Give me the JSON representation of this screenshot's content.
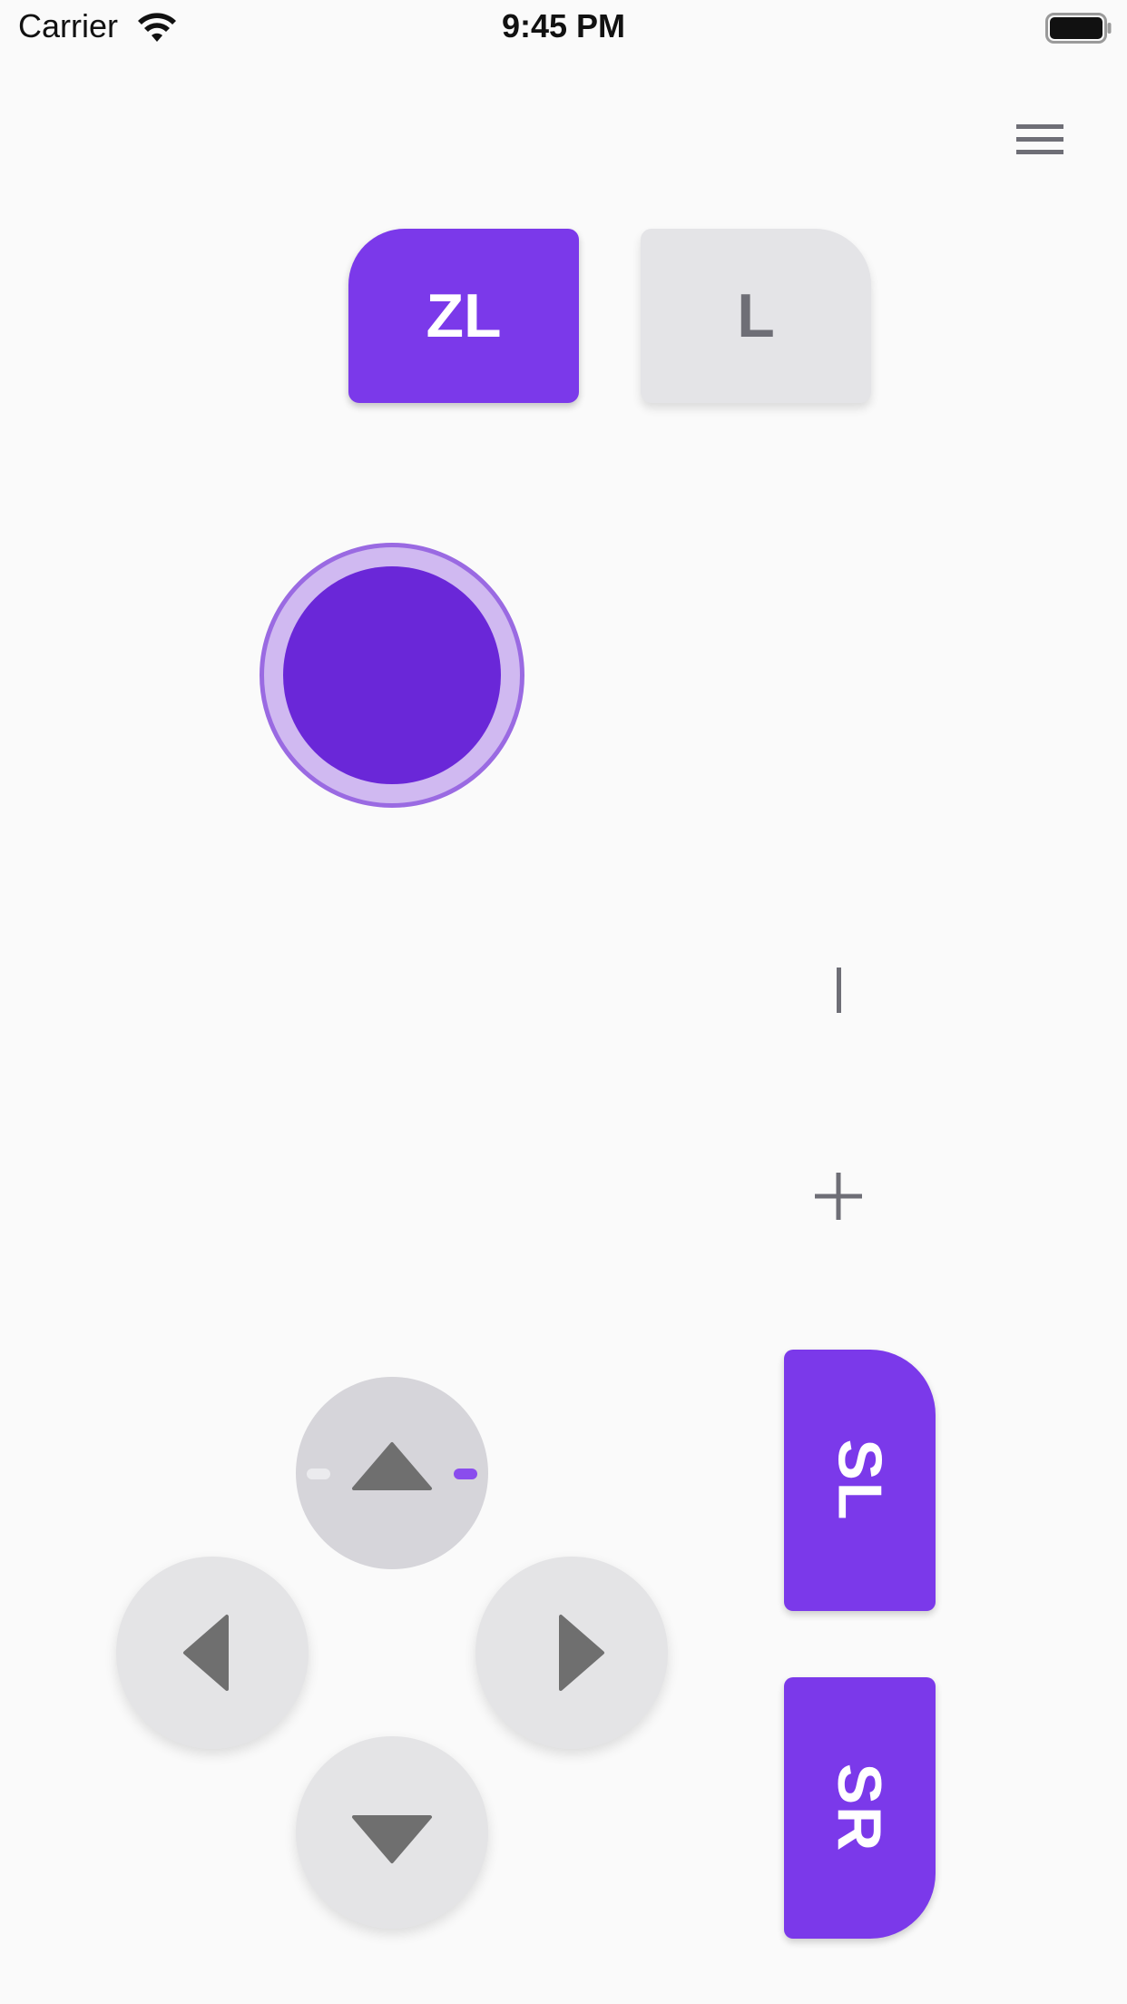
{
  "status_bar": {
    "carrier": "Carrier",
    "time": "9:45 PM",
    "icons": [
      "wifi-icon",
      "battery-icon"
    ]
  },
  "menu": {
    "icon": "hamburger-menu-icon"
  },
  "shoulder_buttons": {
    "zl_label": "ZL",
    "l_label": "L"
  },
  "joystick": {
    "icon": "left-stick"
  },
  "system_buttons": {
    "minus_label": "|",
    "plus_icon": "plus-icon"
  },
  "side_buttons": {
    "sl_label": "SL",
    "sr_label": "SR"
  },
  "dpad": {
    "up_icon": "arrow-up-icon",
    "left_icon": "arrow-left-icon",
    "right_icon": "arrow-right-icon",
    "down_icon": "arrow-down-icon"
  },
  "colors": {
    "accent": "#7b39ea",
    "stick_knob": "#6a27d8",
    "stick_ring": "#d0b9f1",
    "neutral_button": "#e4e4e7",
    "icon_gray": "#6e6e76",
    "arrow_gray": "#6f6f6f",
    "background": "#fafafa"
  }
}
